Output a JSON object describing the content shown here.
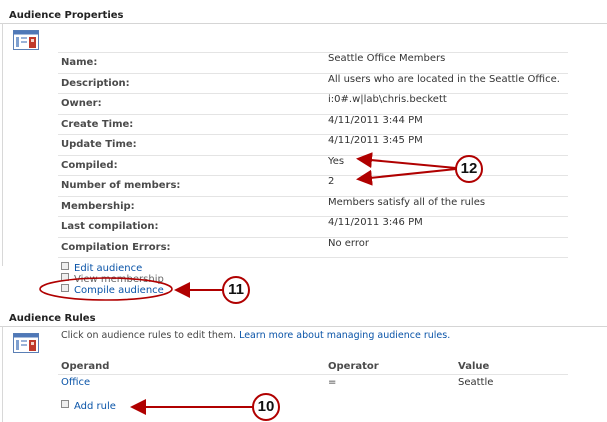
{
  "audience_properties": {
    "title": "Audience Properties",
    "properties": [
      {
        "label": "Name:",
        "value": "Seattle Office Members"
      },
      {
        "label": "Description:",
        "value": "All users who are located in the Seattle Office."
      },
      {
        "label": "Owner:",
        "value": "i:0#.w|lab\\chris.beckett"
      },
      {
        "label": "Create Time:",
        "value": "4/11/2011 3:44 PM"
      },
      {
        "label": "Update Time:",
        "value": "4/11/2011 3:45 PM"
      },
      {
        "label": "Compiled:",
        "value": "Yes"
      },
      {
        "label": "Number of members:",
        "value": "2"
      },
      {
        "label": "Membership:",
        "value": "Members satisfy all of the rules"
      },
      {
        "label": "Last compilation:",
        "value": "4/11/2011 3:46 PM"
      },
      {
        "label": "Compilation Errors:",
        "value": "No error"
      }
    ],
    "actions": {
      "edit": "Edit audience",
      "view": "View membership",
      "compile": "Compile audience"
    }
  },
  "audience_rules": {
    "title": "Audience Rules",
    "intro": "Click on audience rules to edit them.",
    "learn_more": "Learn more about managing audience rules.",
    "headers": {
      "operand": "Operand",
      "operator": "Operator",
      "value": "Value"
    },
    "rules": [
      {
        "operand": "Office",
        "operator": "=",
        "value": "Seattle"
      }
    ],
    "add_rule": "Add rule"
  },
  "callouts": {
    "c10": "10",
    "c11": "11",
    "c12": "12"
  },
  "colors": {
    "link": "#0a54a8",
    "callout_red": "#b00000"
  }
}
